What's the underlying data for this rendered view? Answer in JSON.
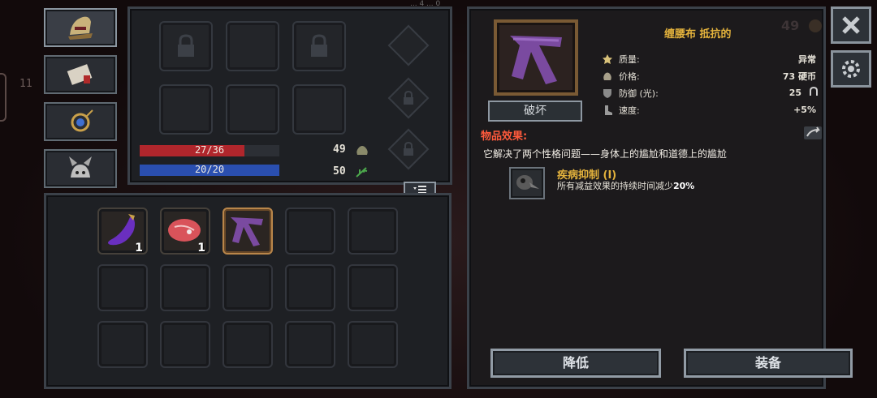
{
  "equipment": {
    "hp_current_max": "27/36",
    "mana_current_max": "20/20",
    "hp_fill": 0.75,
    "mana_fill": 1.0,
    "gold": "49",
    "herbs": "50"
  },
  "inventory": {
    "items": [
      {
        "name": "eggplant",
        "qty": "1"
      },
      {
        "name": "raw-meat",
        "qty": "1"
      },
      {
        "name": "waist-cloth",
        "qty": ""
      }
    ]
  },
  "item": {
    "name": "缠腰布 抵抗的",
    "destroy_label": "破坏",
    "props": [
      {
        "label": "质量:",
        "value": "异常",
        "icon": "star-icon"
      },
      {
        "label": "价格:",
        "value": "73 硬币",
        "icon": "coin-bag-icon"
      },
      {
        "label": "防御 (光):",
        "value": "25",
        "icon": "shield-icon"
      },
      {
        "label": "速度:",
        "value": "+5%",
        "icon": "boot-icon"
      }
    ],
    "effects_title": "物品效果:",
    "description": "它解决了两个性格问题——身体上的尴尬和道德上的尴尬",
    "perk_name": "疾病抑制 (I)",
    "perk_desc_prefix": "所有减益效果的持续时间减少",
    "perk_desc_value": "20%"
  },
  "actions": {
    "lower_label": "降低",
    "equip_label": "装备"
  },
  "hud": {
    "faded_gold": "49",
    "top_clip": "... 4 ... 0",
    "side_num": "11"
  },
  "colors": {
    "accent_gold": "#e3b23c",
    "effect_red": "#ff5a3c",
    "hp_red": "#b0262c",
    "mana_blue": "#2a4fb0"
  }
}
